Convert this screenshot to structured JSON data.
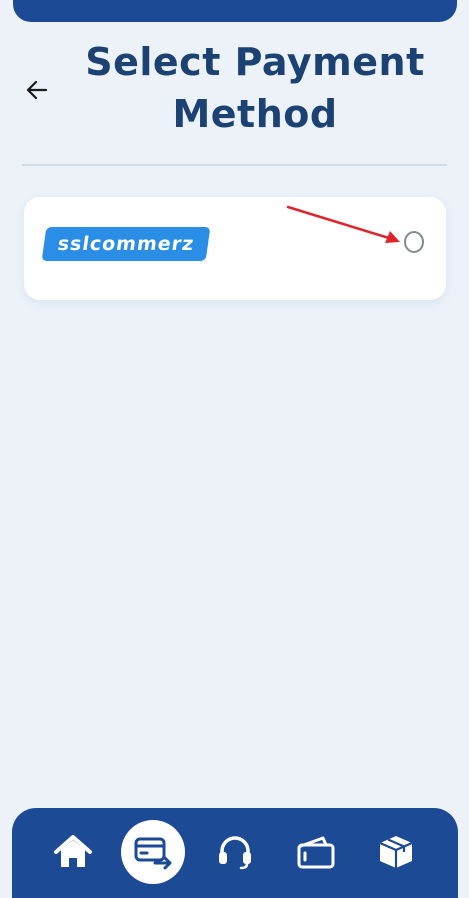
{
  "header": {
    "title": "Select Payment Method",
    "back_icon": "arrow-left-icon"
  },
  "payment_methods": [
    {
      "name": "SSLCOMMERZ",
      "logo_text": "sslcommerz",
      "selected": false
    }
  ],
  "bottom_nav": {
    "items": [
      {
        "icon": "home-icon",
        "active": false
      },
      {
        "icon": "card-transfer-icon",
        "active": true
      },
      {
        "icon": "headset-icon",
        "active": false
      },
      {
        "icon": "wallet-icon",
        "active": false
      },
      {
        "icon": "package-icon",
        "active": false
      }
    ]
  },
  "colors": {
    "primary": "#1c4a94",
    "title": "#1b4272",
    "background": "#ecf2f8",
    "logo": "#2a8de6",
    "annotation_arrow": "#e0242b"
  }
}
